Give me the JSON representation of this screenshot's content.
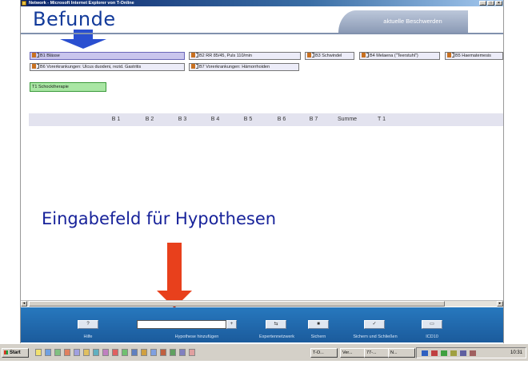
{
  "window": {
    "title": "Network - Microsoft Internet Explorer von T-Online",
    "minimize": "_",
    "maximize": "□",
    "close": "×"
  },
  "header": {
    "befunde_label": "Befunde",
    "tab_label": "aktuelle Beschwerden"
  },
  "findings": [
    {
      "label": "B1 Blässe",
      "selected": true
    },
    {
      "label": "B2 RR 85/45, Puls 110/min",
      "selected": false
    },
    {
      "label": "B3 Schwindel",
      "selected": false
    },
    {
      "label": "B4 Melaena (\"Teerstuhl\")",
      "selected": false
    },
    {
      "label": "B5 Haematemesis",
      "selected": false
    },
    {
      "label": "B6 Vorerkrankungen: Ulcus duodeni, rezid. Gastritis",
      "selected": false
    },
    {
      "label": "B7 Vorerkrankungen: Hämorrhoiden",
      "selected": false
    }
  ],
  "therapy": {
    "label": "T1 Schocktherapie"
  },
  "columns": [
    "B 1",
    "B 2",
    "B 3",
    "B 4",
    "B 5",
    "B 6",
    "B 7",
    "Summe",
    "T 1"
  ],
  "annotation": {
    "hypothesis_field_label": "Eingabefeld für Hypothesen"
  },
  "toolbar": {
    "help_label": "Hilfe",
    "hypothesis_input_value": "",
    "hypothesis_add_label": "Hypothese hinzufügen",
    "expert_label": "Expertennetzwerk",
    "save_label": "Sichern",
    "save_close_label": "Sichern und Schließen",
    "icd_label": "ICD10"
  },
  "taskbar": {
    "start_label": "Start",
    "tasks": [
      "T-O...",
      "Ver...",
      "77-...",
      "N..."
    ],
    "clock": "10:31"
  },
  "colors": {
    "heading_blue": "#123a9a",
    "arrow_blue": "#2a4fd0",
    "arrow_red": "#e8401c",
    "toolbar_blue": "#1f66aa",
    "selected_chip": "#c9c5ed",
    "therapy_green": "#a9e6a4"
  },
  "icons": [
    "blue-down-arrow",
    "red-down-arrow",
    "help-icon",
    "add-icon",
    "network-icon",
    "floppy-disk-icon",
    "save-close-icon",
    "icd-icon"
  ]
}
